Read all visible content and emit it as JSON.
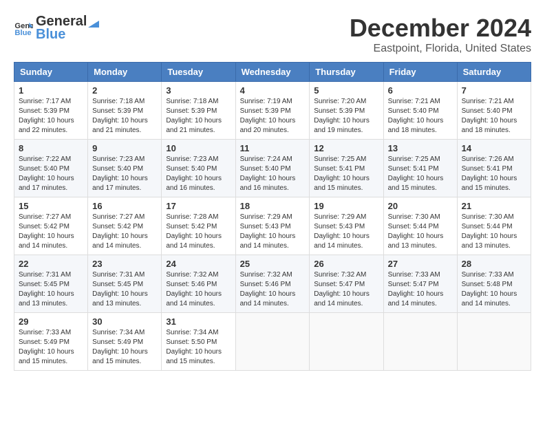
{
  "header": {
    "logo_general": "General",
    "logo_blue": "Blue",
    "title": "December 2024",
    "location": "Eastpoint, Florida, United States"
  },
  "weekdays": [
    "Sunday",
    "Monday",
    "Tuesday",
    "Wednesday",
    "Thursday",
    "Friday",
    "Saturday"
  ],
  "weeks": [
    [
      {
        "day": "1",
        "sunrise": "7:17 AM",
        "sunset": "5:39 PM",
        "daylight": "10 hours and 22 minutes."
      },
      {
        "day": "2",
        "sunrise": "7:18 AM",
        "sunset": "5:39 PM",
        "daylight": "10 hours and 21 minutes."
      },
      {
        "day": "3",
        "sunrise": "7:18 AM",
        "sunset": "5:39 PM",
        "daylight": "10 hours and 21 minutes."
      },
      {
        "day": "4",
        "sunrise": "7:19 AM",
        "sunset": "5:39 PM",
        "daylight": "10 hours and 20 minutes."
      },
      {
        "day": "5",
        "sunrise": "7:20 AM",
        "sunset": "5:39 PM",
        "daylight": "10 hours and 19 minutes."
      },
      {
        "day": "6",
        "sunrise": "7:21 AM",
        "sunset": "5:40 PM",
        "daylight": "10 hours and 18 minutes."
      },
      {
        "day": "7",
        "sunrise": "7:21 AM",
        "sunset": "5:40 PM",
        "daylight": "10 hours and 18 minutes."
      }
    ],
    [
      {
        "day": "8",
        "sunrise": "7:22 AM",
        "sunset": "5:40 PM",
        "daylight": "10 hours and 17 minutes."
      },
      {
        "day": "9",
        "sunrise": "7:23 AM",
        "sunset": "5:40 PM",
        "daylight": "10 hours and 17 minutes."
      },
      {
        "day": "10",
        "sunrise": "7:23 AM",
        "sunset": "5:40 PM",
        "daylight": "10 hours and 16 minutes."
      },
      {
        "day": "11",
        "sunrise": "7:24 AM",
        "sunset": "5:40 PM",
        "daylight": "10 hours and 16 minutes."
      },
      {
        "day": "12",
        "sunrise": "7:25 AM",
        "sunset": "5:41 PM",
        "daylight": "10 hours and 15 minutes."
      },
      {
        "day": "13",
        "sunrise": "7:25 AM",
        "sunset": "5:41 PM",
        "daylight": "10 hours and 15 minutes."
      },
      {
        "day": "14",
        "sunrise": "7:26 AM",
        "sunset": "5:41 PM",
        "daylight": "10 hours and 15 minutes."
      }
    ],
    [
      {
        "day": "15",
        "sunrise": "7:27 AM",
        "sunset": "5:42 PM",
        "daylight": "10 hours and 14 minutes."
      },
      {
        "day": "16",
        "sunrise": "7:27 AM",
        "sunset": "5:42 PM",
        "daylight": "10 hours and 14 minutes."
      },
      {
        "day": "17",
        "sunrise": "7:28 AM",
        "sunset": "5:42 PM",
        "daylight": "10 hours and 14 minutes."
      },
      {
        "day": "18",
        "sunrise": "7:29 AM",
        "sunset": "5:43 PM",
        "daylight": "10 hours and 14 minutes."
      },
      {
        "day": "19",
        "sunrise": "7:29 AM",
        "sunset": "5:43 PM",
        "daylight": "10 hours and 14 minutes."
      },
      {
        "day": "20",
        "sunrise": "7:30 AM",
        "sunset": "5:44 PM",
        "daylight": "10 hours and 13 minutes."
      },
      {
        "day": "21",
        "sunrise": "7:30 AM",
        "sunset": "5:44 PM",
        "daylight": "10 hours and 13 minutes."
      }
    ],
    [
      {
        "day": "22",
        "sunrise": "7:31 AM",
        "sunset": "5:45 PM",
        "daylight": "10 hours and 13 minutes."
      },
      {
        "day": "23",
        "sunrise": "7:31 AM",
        "sunset": "5:45 PM",
        "daylight": "10 hours and 13 minutes."
      },
      {
        "day": "24",
        "sunrise": "7:32 AM",
        "sunset": "5:46 PM",
        "daylight": "10 hours and 14 minutes."
      },
      {
        "day": "25",
        "sunrise": "7:32 AM",
        "sunset": "5:46 PM",
        "daylight": "10 hours and 14 minutes."
      },
      {
        "day": "26",
        "sunrise": "7:32 AM",
        "sunset": "5:47 PM",
        "daylight": "10 hours and 14 minutes."
      },
      {
        "day": "27",
        "sunrise": "7:33 AM",
        "sunset": "5:47 PM",
        "daylight": "10 hours and 14 minutes."
      },
      {
        "day": "28",
        "sunrise": "7:33 AM",
        "sunset": "5:48 PM",
        "daylight": "10 hours and 14 minutes."
      }
    ],
    [
      {
        "day": "29",
        "sunrise": "7:33 AM",
        "sunset": "5:49 PM",
        "daylight": "10 hours and 15 minutes."
      },
      {
        "day": "30",
        "sunrise": "7:34 AM",
        "sunset": "5:49 PM",
        "daylight": "10 hours and 15 minutes."
      },
      {
        "day": "31",
        "sunrise": "7:34 AM",
        "sunset": "5:50 PM",
        "daylight": "10 hours and 15 minutes."
      },
      null,
      null,
      null,
      null
    ]
  ]
}
